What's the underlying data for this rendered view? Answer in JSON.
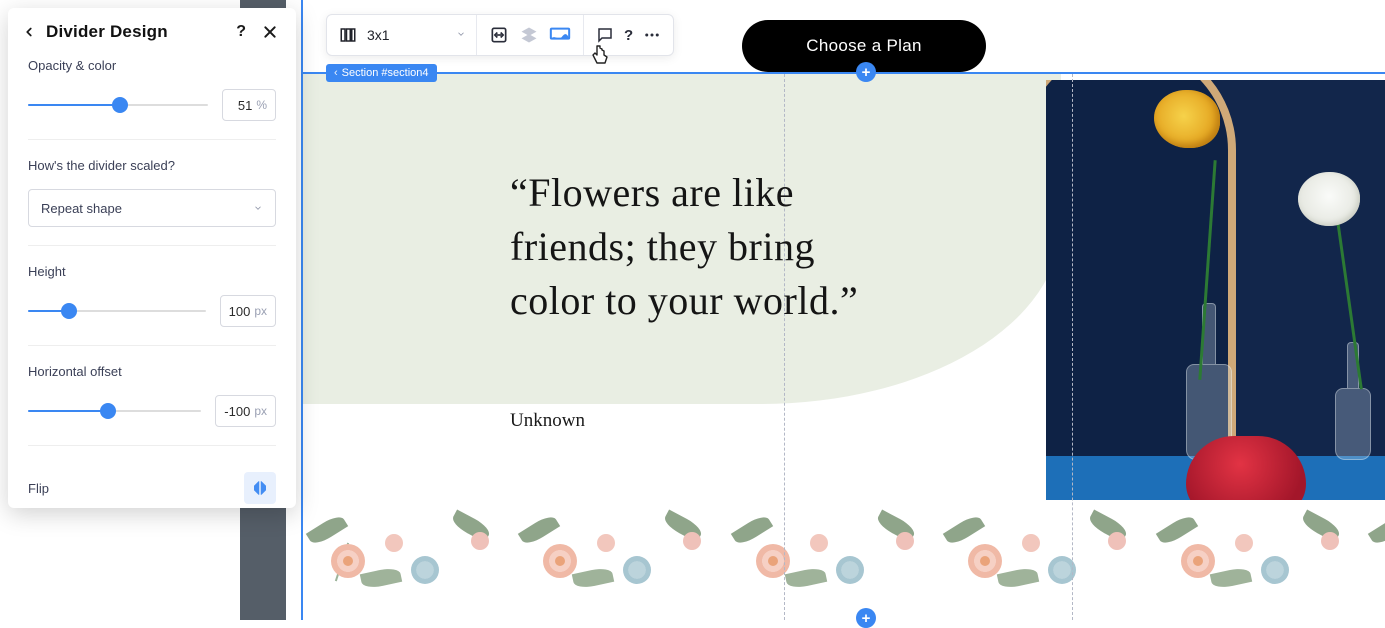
{
  "panel": {
    "title": "Divider Design",
    "opacity_label": "Opacity & color",
    "opacity_value": "51",
    "opacity_unit": "%",
    "scale_label": "How's the divider scaled?",
    "scale_value": "Repeat shape",
    "height_label": "Height",
    "height_value": "100",
    "height_unit": "px",
    "offset_label": "Horizontal offset",
    "offset_value": "-100",
    "offset_unit": "px",
    "flip_label": "Flip"
  },
  "toolbar": {
    "grid_label": "3x1"
  },
  "section_tag": "Section #section4",
  "plan_button": "Choose a Plan",
  "quote_text": "“Flowers are like friends; they bring color to your world.”",
  "quote_author": "Unknown"
}
